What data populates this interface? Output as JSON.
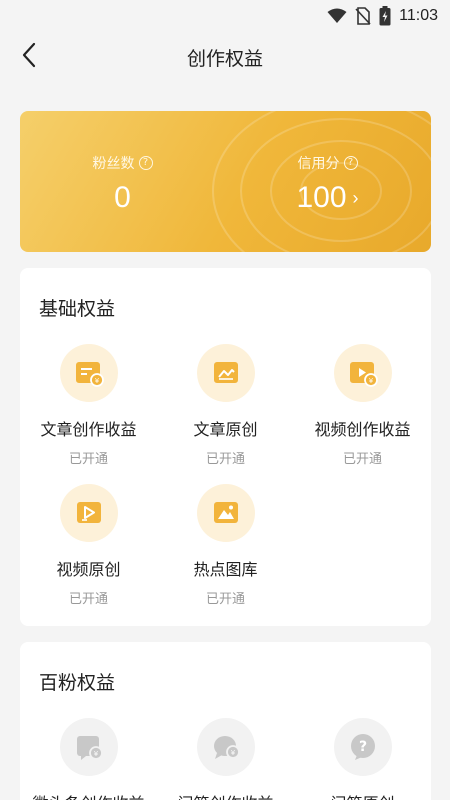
{
  "status_bar": {
    "time": "11:03"
  },
  "header": {
    "title": "创作权益"
  },
  "score_card": {
    "fans_label": "粉丝数",
    "fans_value": "0",
    "credit_label": "信用分",
    "credit_value": "100",
    "help_glyph": "?",
    "arrow_glyph": "›"
  },
  "basic_section": {
    "title": "基础权益",
    "items": [
      {
        "name": "文章创作收益",
        "status": "已开通",
        "icon": "article-income-icon"
      },
      {
        "name": "文章原创",
        "status": "已开通",
        "icon": "article-original-icon"
      },
      {
        "name": "视频创作收益",
        "status": "已开通",
        "icon": "video-income-icon"
      },
      {
        "name": "视频原创",
        "status": "已开通",
        "icon": "video-original-icon"
      },
      {
        "name": "热点图库",
        "status": "已开通",
        "icon": "image-library-icon"
      }
    ]
  },
  "hundred_fans_section": {
    "title": "百粉权益",
    "items": [
      {
        "name": "微头条创作收益",
        "icon": "weitoutiao-income-icon"
      },
      {
        "name": "问答创作收益",
        "icon": "qa-income-icon"
      },
      {
        "name": "问答原创",
        "icon": "qa-original-icon"
      }
    ]
  },
  "colors": {
    "gold": "#f0b73a",
    "gold_light": "#fdf1d9",
    "icon_gold": "#f2b43c",
    "disabled_grey": "#c8c8c8"
  }
}
